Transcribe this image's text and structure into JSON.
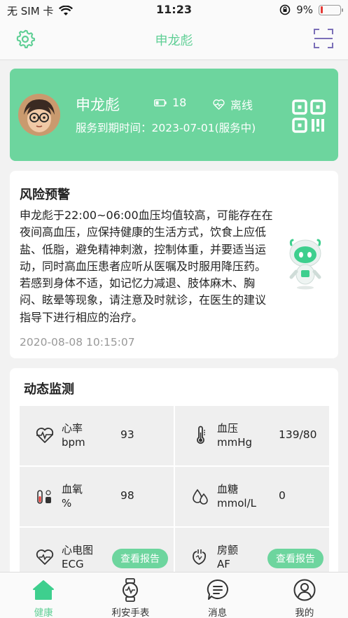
{
  "status_bar": {
    "carrier": "无 SIM 卡",
    "time": "11:23",
    "battery_percent": "9%",
    "battery_level": 0.09,
    "wifi_icon": "wifi-icon",
    "rotation_lock_icon": "rotation-lock-icon"
  },
  "nav": {
    "title": "申龙彪",
    "left_icon": "gear-icon",
    "right_icon": "scan-icon"
  },
  "profile": {
    "name": "申龙彪",
    "battery_value": "18",
    "status": "离线",
    "expiry": "服务到期时间：2023-07-01(服务中)"
  },
  "risk": {
    "title": "风险预警",
    "body": "申龙彪于22:00~06:00血压均值较高，可能存在在夜间高血压，应保持健康的生活方式，饮食上应低盐、低脂，避免精神刺激，控制体重，并要适当运动，同时高血压患者应听从医嘱及时服用降压药。若感到身体不适，如记忆力减退、肢体麻木、胸闷、眩晕等现象，请注意及时就诊，在医生的建议指导下进行相应的治疗。",
    "timestamp": "2020-08-08 10:15:07"
  },
  "monitor": {
    "title": "动态监测",
    "report_label": "查看报告",
    "items": [
      {
        "name": "心率",
        "unit": "bpm",
        "value": "93",
        "icon": "heart-rate-icon"
      },
      {
        "name": "血压",
        "unit": "mmHg",
        "value": "139/80",
        "icon": "thermometer-icon"
      },
      {
        "name": "血氧",
        "unit": "%",
        "value": "98",
        "icon": "blood-oxygen-icon"
      },
      {
        "name": "血糖",
        "unit": "mmol/L",
        "value": "0",
        "icon": "blood-drop-icon"
      },
      {
        "name": "心电图",
        "unit": "ECG",
        "value": "",
        "icon": "ecg-heart-icon"
      },
      {
        "name": "房颤",
        "unit": "AF",
        "value": "",
        "icon": "af-heart-icon"
      }
    ]
  },
  "tabs": [
    {
      "label": "健康",
      "icon": "home-icon",
      "active": true
    },
    {
      "label": "利安手表",
      "icon": "watch-icon",
      "active": false
    },
    {
      "label": "消息",
      "icon": "message-icon",
      "active": false
    },
    {
      "label": "我的",
      "icon": "user-icon",
      "active": false
    }
  ],
  "colors": {
    "accent": "#6dd59e",
    "accent_text": "#5fcf95",
    "scan_icon": "#7b6fb8"
  }
}
